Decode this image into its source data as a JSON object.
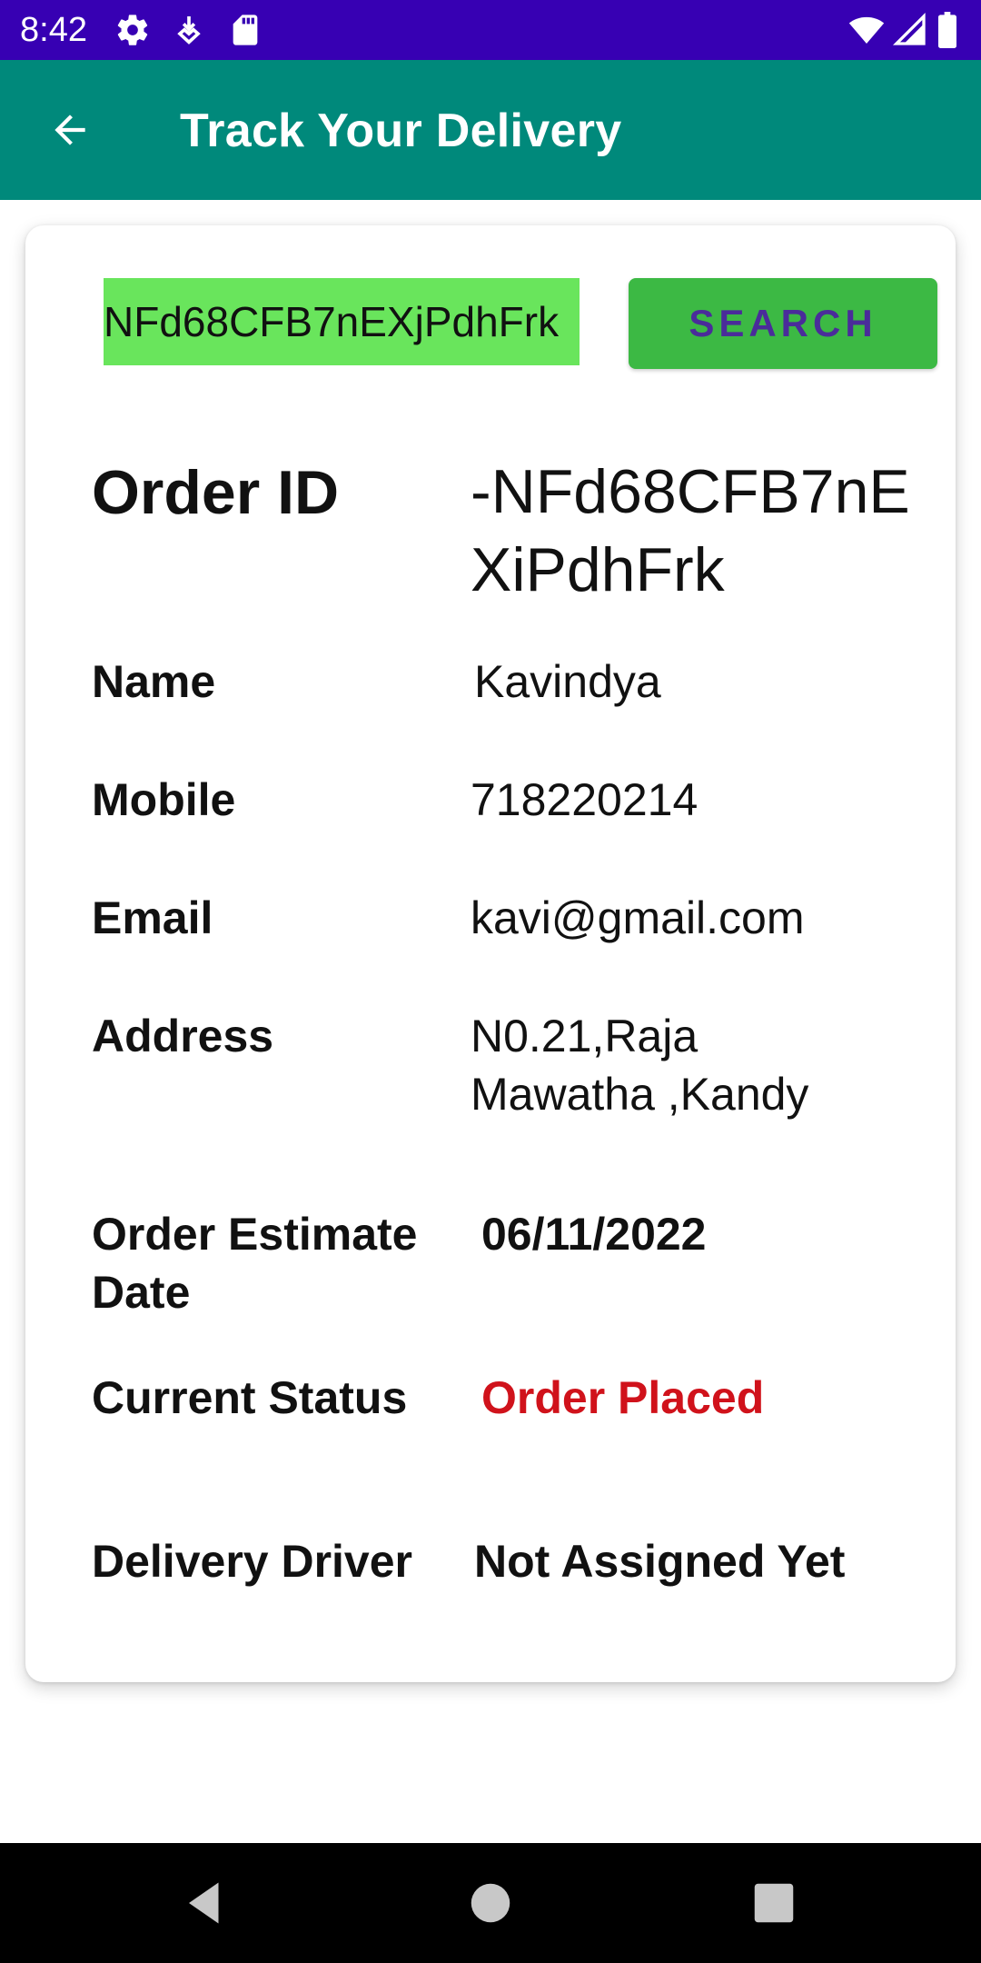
{
  "status_bar": {
    "time": "8:42",
    "icons": [
      "settings-icon",
      "download-icon",
      "sd-card-icon",
      "wifi-icon",
      "signal-icon",
      "battery-icon"
    ]
  },
  "app_bar": {
    "title": "Track Your Delivery",
    "back_icon": "arrow-back-icon"
  },
  "search": {
    "value": "NFd68CFB7nEXjPdhFrk",
    "button_label": "SEARCH"
  },
  "details": {
    "order_id_label": "Order ID",
    "order_id_value": "-NFd68CFB7nEXiPdhFrk",
    "name_label": "Name",
    "name_value": "Kavindya",
    "mobile_label": "Mobile",
    "mobile_value": "718220214",
    "email_label": "Email",
    "email_value": "kavi@gmail.com",
    "address_label": "Address",
    "address_value": "N0.21,Raja Mawatha ,Kandy",
    "estimate_label": "Order Estimate Date",
    "estimate_value": "06/11/2022",
    "status_label": "Current Status",
    "status_value": "Order Placed",
    "driver_label": "Delivery Driver",
    "driver_value": "Not Assigned Yet"
  },
  "colors": {
    "status_bar": "#3700b3",
    "app_bar": "#00897b",
    "search_input_bg": "#69e55c",
    "search_button_bg": "#3cb944",
    "status_value": "#d0121b"
  },
  "nav_bar": {
    "buttons": [
      "back-triangle-icon",
      "home-circle-icon",
      "recents-square-icon"
    ]
  }
}
